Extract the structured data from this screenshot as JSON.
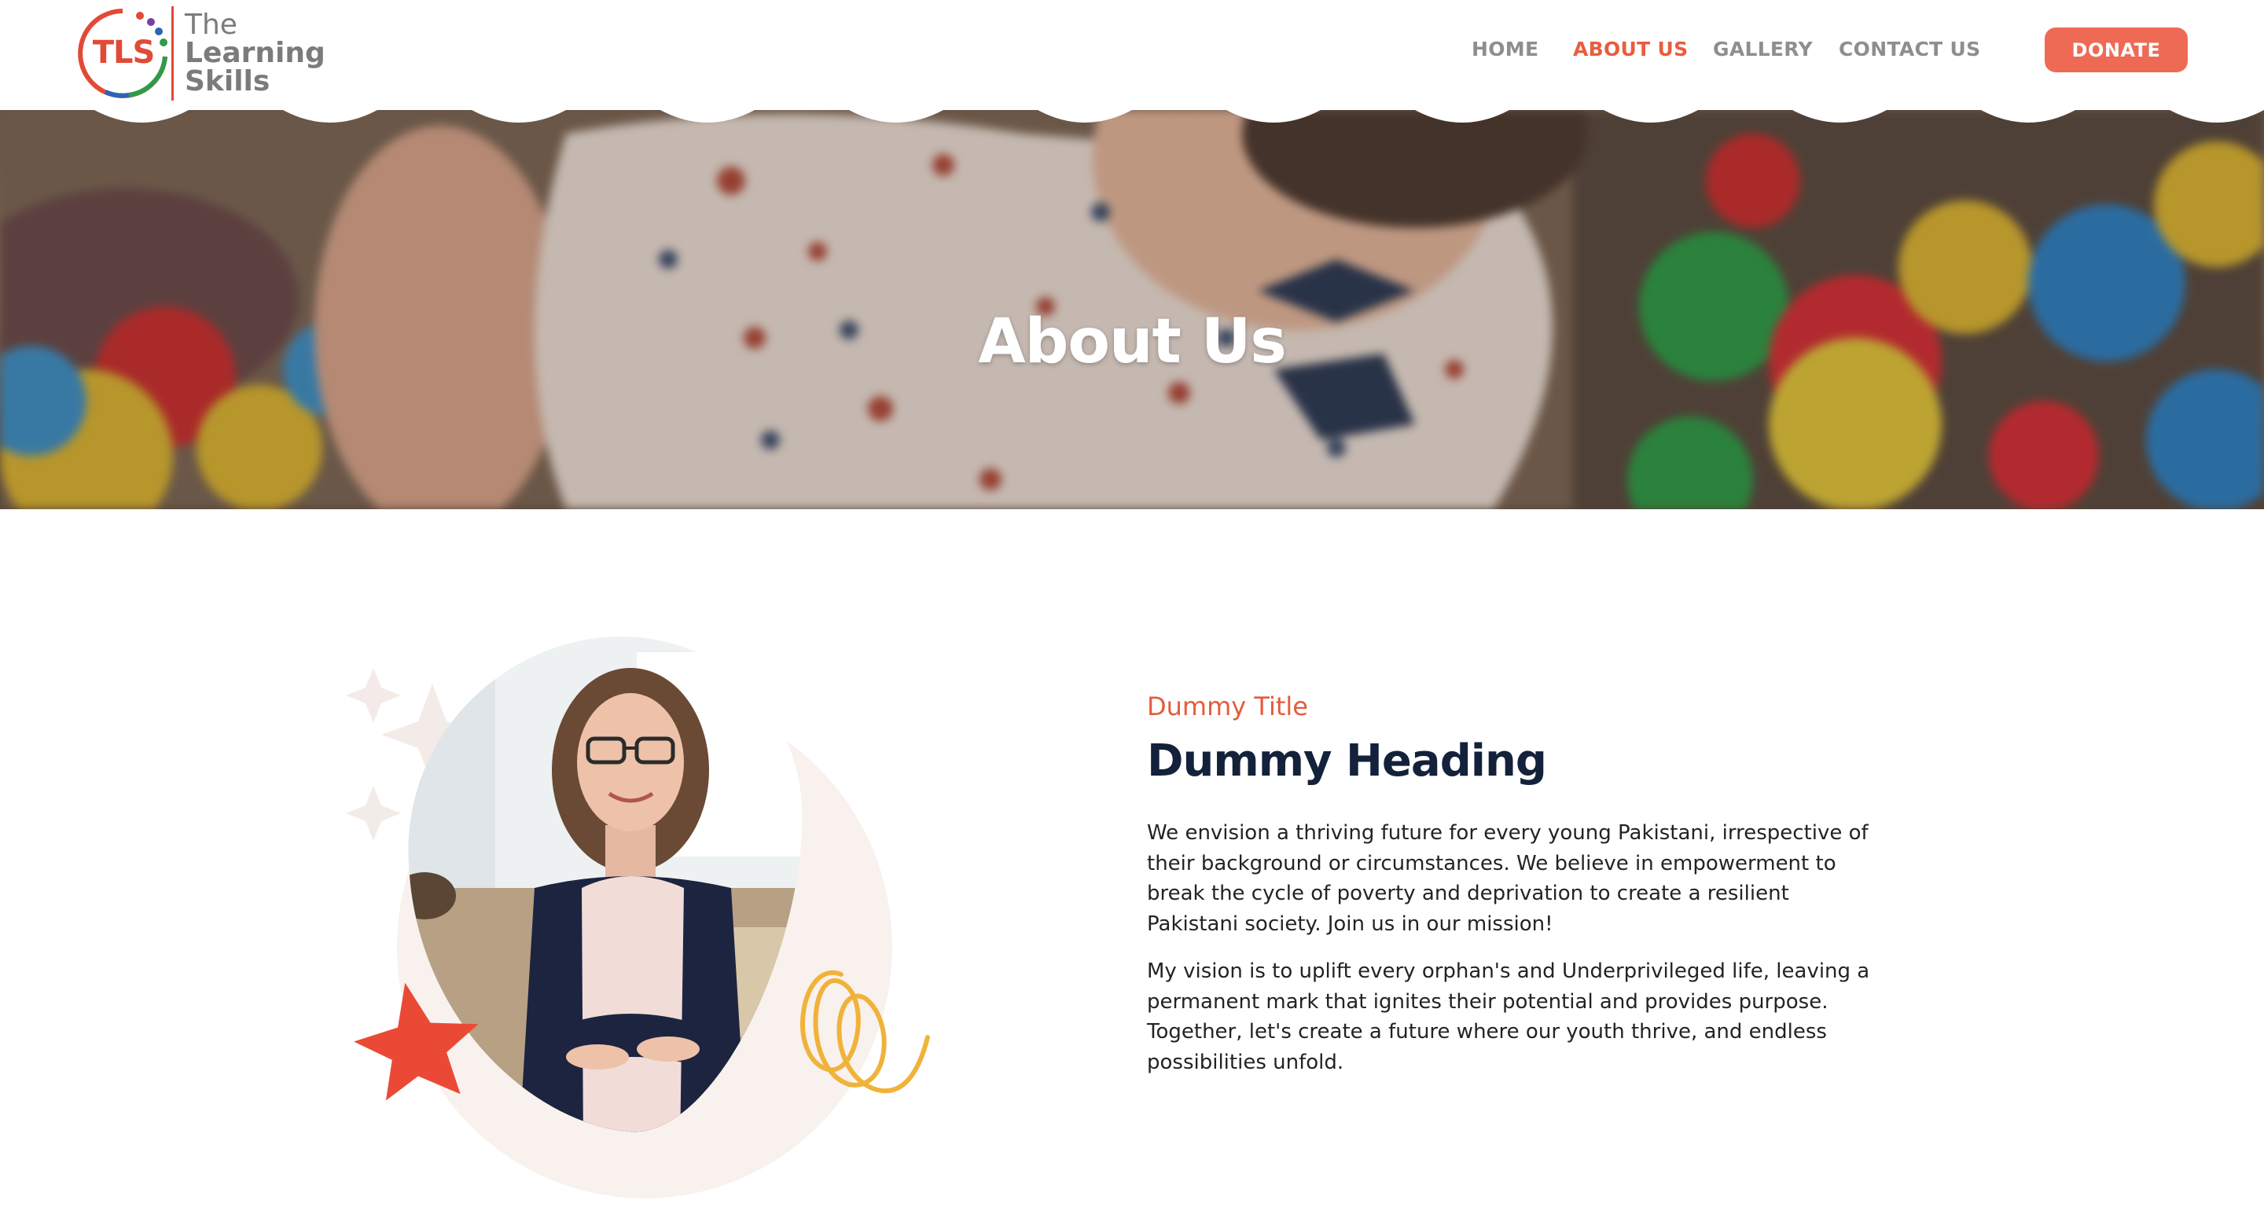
{
  "brand": {
    "mark": "TLS",
    "name_line1": "The",
    "name_line2": "Learning",
    "name_line3": "Skills"
  },
  "nav": {
    "items": [
      {
        "label": "HOME",
        "active": false
      },
      {
        "label": "ABOUT US",
        "active": true
      },
      {
        "label": "GALLERY",
        "active": false
      },
      {
        "label": "CONTACT US",
        "active": false
      }
    ],
    "donate_label": "DONATE"
  },
  "hero": {
    "title": "About Us"
  },
  "about": {
    "eyebrow": "Dummy Title",
    "heading": "Dummy Heading",
    "paragraphs": [
      "We envision a thriving future for every young Pakistani, irrespective of their background or circumstances. We believe in empowerment to break the cycle of poverty and deprivation to create a resilient Pakistani society. Join us in our mission!",
      "My vision is to uplift every orphan's and Underprivileged life, leaving a permanent mark that ignites their potential and provides purpose. Together, let's create a future where our youth thrive, and endless possibilities unfold."
    ]
  },
  "colors": {
    "accent": "#e85d3f",
    "donate_bg": "#ee6a55",
    "heading": "#13213a",
    "nav_text": "#8e8e8e"
  }
}
